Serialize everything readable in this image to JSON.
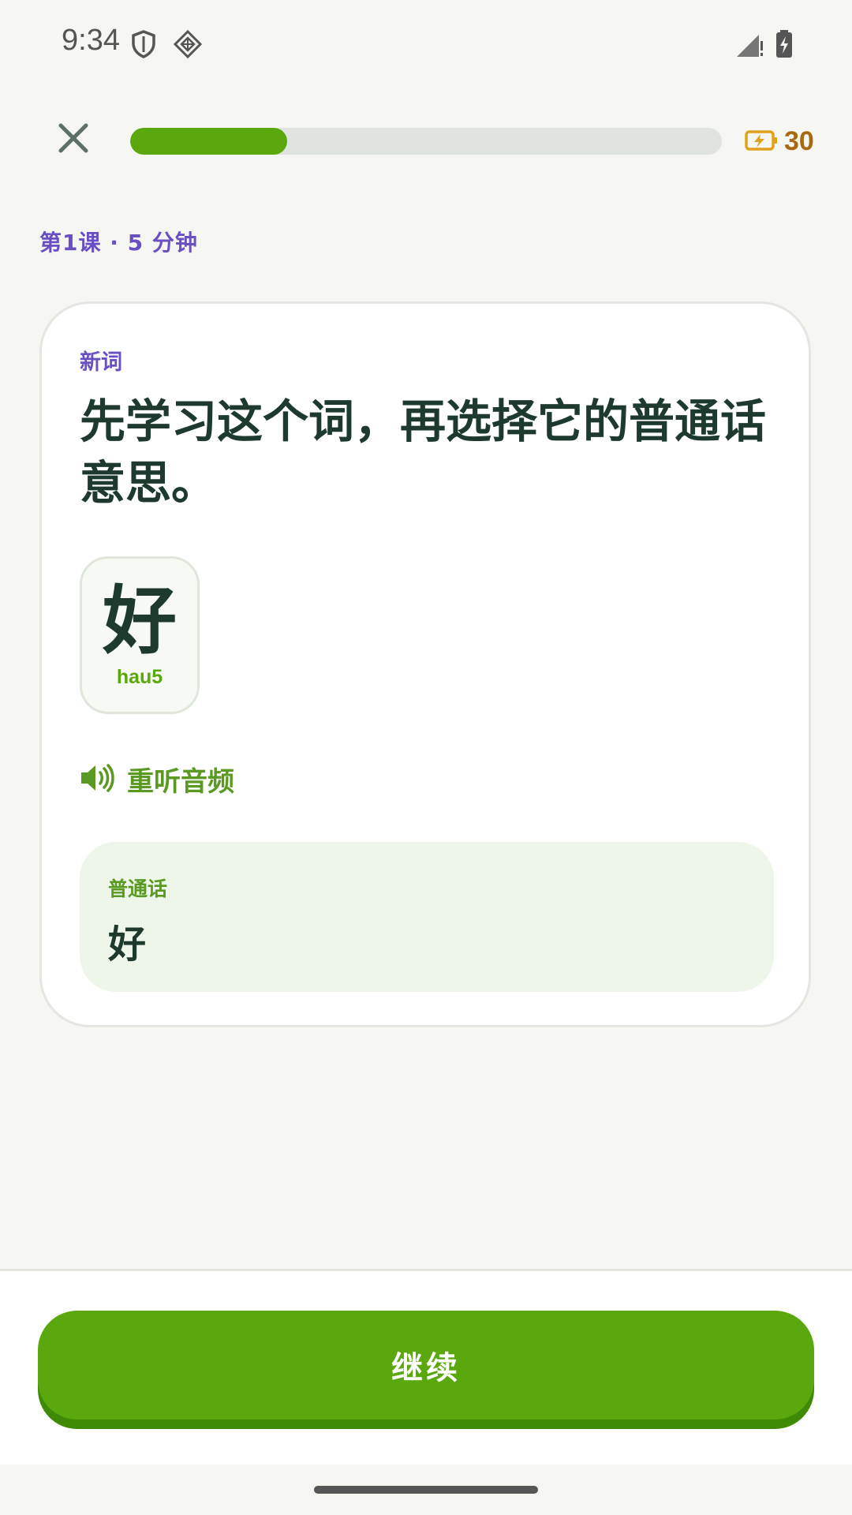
{
  "status_bar": {
    "time": "9:34",
    "icons": [
      "shield-icon",
      "diamond-grid-icon",
      "signal-icon",
      "battery-charging-icon"
    ]
  },
  "top_bar": {
    "progress": 0.265,
    "energy_value": "30",
    "colors": {
      "progress_fill": "#5aa80e",
      "progress_track": "#e0e4e0",
      "energy": "#a86a10"
    }
  },
  "lesson": {
    "meta": "第1课 · 5 分钟"
  },
  "card": {
    "label": "新词",
    "prompt": "先学习这个词，再选择它的普通话意思。",
    "word": {
      "character": "好",
      "romanization": "hau5"
    },
    "replay_label": "重听音频",
    "translation": {
      "language": "普通话",
      "text": "好"
    }
  },
  "footer": {
    "continue_label": "继续",
    "accent": "#5aa80e"
  }
}
